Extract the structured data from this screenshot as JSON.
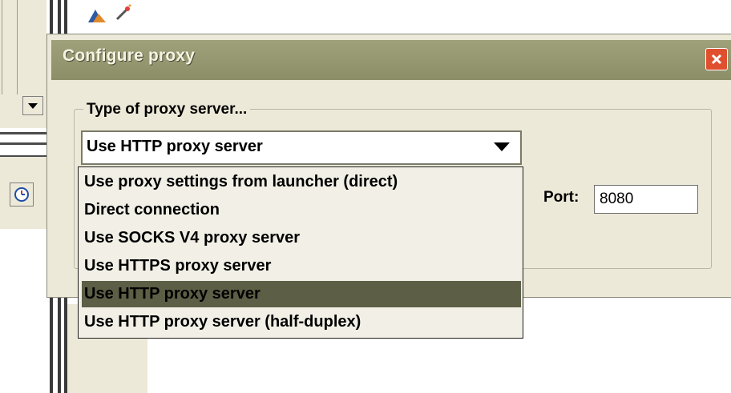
{
  "dialog": {
    "title": "Configure proxy",
    "close_icon": "close-icon"
  },
  "proxy_group": {
    "legend": "Type of proxy server...",
    "combo": {
      "selected": "Use HTTP proxy server",
      "arrow_icon": "chevron-down-icon"
    },
    "options": [
      {
        "label": "Use proxy settings from launcher (direct)",
        "selected": false
      },
      {
        "label": "Direct connection",
        "selected": false
      },
      {
        "label": "Use SOCKS V4 proxy server",
        "selected": false
      },
      {
        "label": "Use HTTPS proxy server",
        "selected": false
      },
      {
        "label": "Use HTTP proxy server",
        "selected": true
      },
      {
        "label": "Use HTTP proxy server (half-duplex)",
        "selected": false
      }
    ]
  },
  "port": {
    "label": "Port:",
    "value": "8080"
  },
  "colors": {
    "dialog_bg": "#ece9d8",
    "titlebar": "#9a9c76",
    "selection": "#5c5e45",
    "close_button": "#e0502e"
  }
}
